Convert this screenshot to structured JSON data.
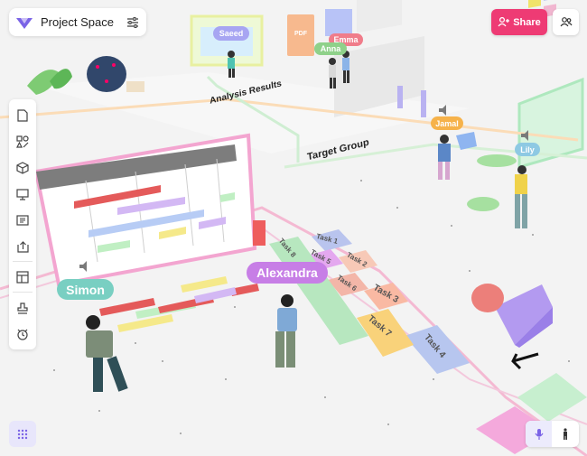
{
  "header": {
    "title": "Project Space",
    "share_label": "Share"
  },
  "floor": {
    "analysis_results": "Analysis Results",
    "target_group": "Target Group",
    "doc_label": "PDF"
  },
  "avatars": [
    {
      "name": "Saeed",
      "color": "#a7a5f2"
    },
    {
      "name": "Emma",
      "color": "#f07c8a"
    },
    {
      "name": "Anna",
      "color": "#8fd18a"
    },
    {
      "name": "Jamal",
      "color": "#f6b24a"
    },
    {
      "name": "Lily",
      "color": "#8ec9e3"
    },
    {
      "name": "Alexandra",
      "color": "#c77ee6"
    },
    {
      "name": "Simon",
      "color": "#79cfc2"
    }
  ],
  "tasks": [
    {
      "label": "Task 1",
      "color": "#b9c4ee"
    },
    {
      "label": "Task 2",
      "color": "#f7c9b7"
    },
    {
      "label": "Task 3",
      "color": "#f9b9a3"
    },
    {
      "label": "Task 4",
      "color": "#b7c6ef"
    },
    {
      "label": "Task 5",
      "color": "#e4a8ef"
    },
    {
      "label": "Task 6",
      "color": "#f3b6a8"
    },
    {
      "label": "Task 7",
      "color": "#f9d27a"
    },
    {
      "label": "Task 8",
      "color": "#b7e7bf"
    }
  ],
  "colors": {
    "accent": "#ee3b74",
    "primary": "#7a63e6",
    "floor": "#f4f4f4"
  }
}
